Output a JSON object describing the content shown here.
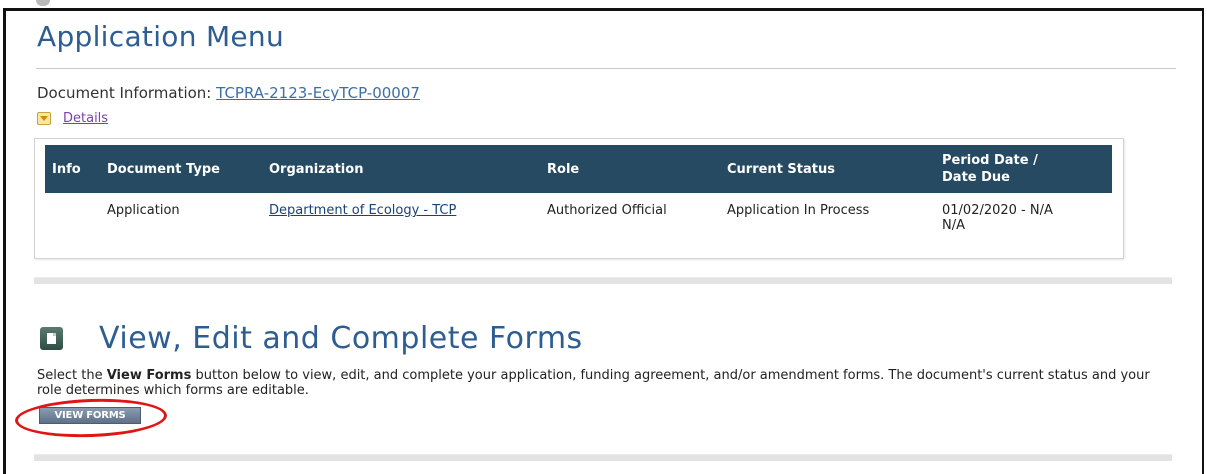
{
  "page": {
    "title": "Application Menu"
  },
  "document_info": {
    "label": "Document Information:",
    "link_text": "TCPRA-2123-EcyTCP-00007"
  },
  "details": {
    "label": "Details"
  },
  "table": {
    "headers": [
      "Info",
      "Document Type",
      "Organization",
      "Role",
      "Current Status",
      "Period Date /",
      "Date Due"
    ],
    "row": {
      "info": "",
      "document_type": "Application",
      "organization": "Department of Ecology - TCP",
      "role": "Authorized Official",
      "current_status": "Application In Process",
      "period_line1": "01/02/2020 - N/A",
      "period_line2": "N/A"
    },
    "header_color": "#274a63"
  },
  "forms_section": {
    "title": "View, Edit and Complete Forms",
    "instr_prefix": "Select the ",
    "instr_bold": "View Forms",
    "instr_suffix": " button below to view, edit, and complete your application, funding agreement, and/or amendment forms. The document's current status and your role determines which forms are editable.",
    "button_label": "VIEW FORMS"
  },
  "colors": {
    "title_blue": "#2e5d92",
    "highlight_circle": "#e01515"
  }
}
